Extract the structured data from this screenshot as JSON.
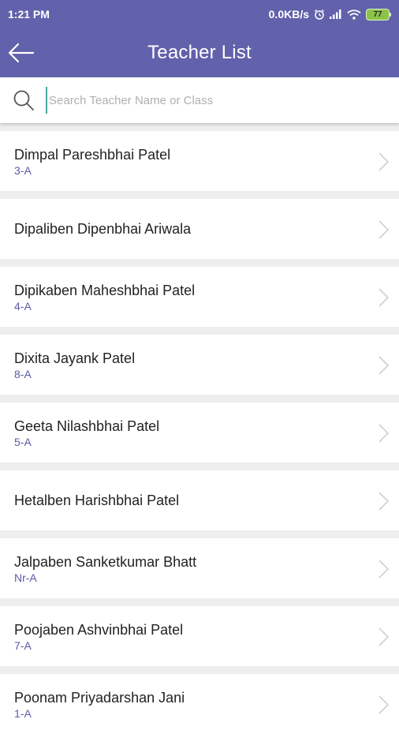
{
  "status_bar": {
    "time": "1:21 PM",
    "network_speed": "0.0KB/s",
    "battery": "77"
  },
  "header": {
    "title": "Teacher List",
    "color": "#6261ab"
  },
  "search": {
    "placeholder": "Search Teacher Name or Class",
    "value": ""
  },
  "teachers": [
    {
      "name": "Dimpal Pareshbhai Patel",
      "class": "3-A"
    },
    {
      "name": "Dipaliben Dipenbhai Ariwala",
      "class": ""
    },
    {
      "name": "Dipikaben Maheshbhai Patel",
      "class": "4-A"
    },
    {
      "name": "Dixita Jayank Patel",
      "class": "8-A"
    },
    {
      "name": "Geeta Nilashbhai Patel",
      "class": "5-A"
    },
    {
      "name": "Hetalben Harishbhai Patel",
      "class": ""
    },
    {
      "name": "Jalpaben Sanketkumar Bhatt",
      "class": "Nr-A"
    },
    {
      "name": "Poojaben Ashvinbhai Patel",
      "class": "7-A"
    },
    {
      "name": "Poonam Priyadarshan Jani",
      "class": "1-A"
    }
  ]
}
